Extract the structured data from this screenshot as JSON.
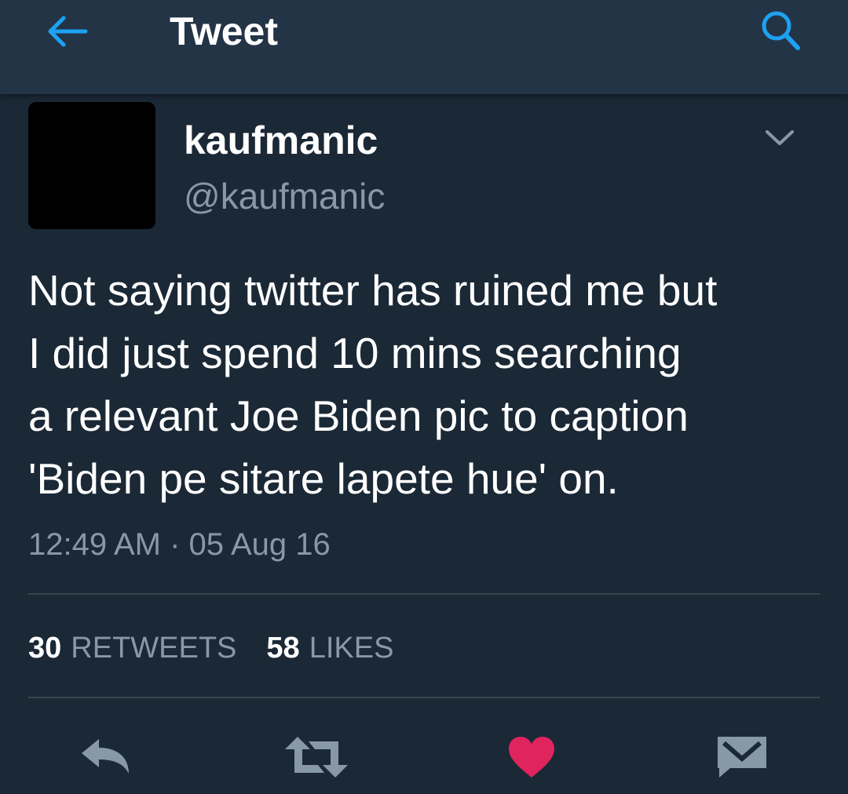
{
  "header": {
    "title": "Tweet",
    "back_icon": "arrow-left-icon",
    "search_icon": "search-icon",
    "accent_color": "#1da1f2"
  },
  "tweet": {
    "display_name": "kaufmanic",
    "handle": "@kaufmanic",
    "text": "Not saying twitter has ruined me but\nI did just spend 10 mins searching\na relevant Joe Biden pic to caption\n'Biden pe sitare lapete hue' on.",
    "timestamp": "12:49 AM · 05 Aug 16",
    "menu_icon": "chevron-down-icon"
  },
  "stats": {
    "retweets_count": "30",
    "retweets_label": "RETWEETS",
    "likes_count": "58",
    "likes_label": "LIKES"
  },
  "actions": {
    "reply_icon": "reply-icon",
    "retweet_icon": "retweet-icon",
    "like_icon": "heart-icon",
    "message_icon": "direct-message-icon",
    "like_color": "#e0245e",
    "icon_color": "#8899a6"
  },
  "theme": {
    "background": "#1b2836",
    "header_background": "#243447"
  }
}
